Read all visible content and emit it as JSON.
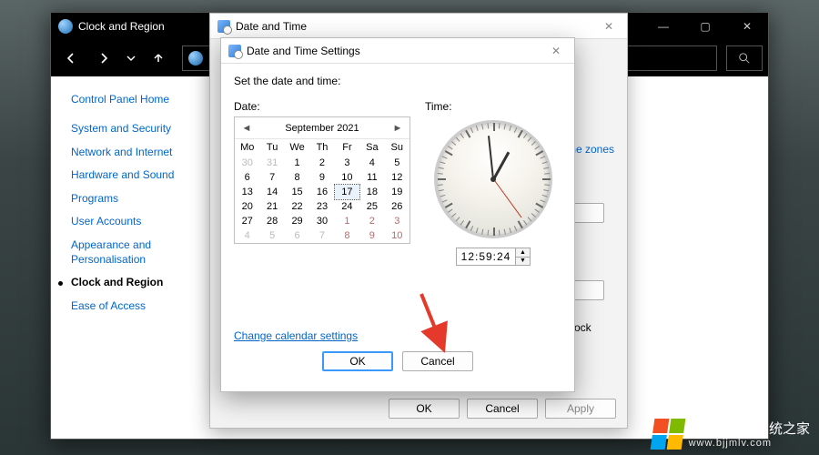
{
  "outer_window": {
    "title": "Clock and Region"
  },
  "sidebar": {
    "home": "Control Panel Home",
    "items": [
      {
        "label": "System and Security"
      },
      {
        "label": "Network and Internet"
      },
      {
        "label": "Hardware and Sound"
      },
      {
        "label": "Programs"
      },
      {
        "label": "User Accounts"
      },
      {
        "label": "Appearance and Personalisation"
      },
      {
        "label": "Clock and Region",
        "active": true
      },
      {
        "label": "Ease of Access"
      }
    ]
  },
  "dlg1": {
    "title": "Date and Time",
    "link_fragment": "fferent time zones",
    "ock_fragment": "ock",
    "buttons": {
      "ok": "OK",
      "cancel": "Cancel",
      "apply": "Apply"
    }
  },
  "dlg2": {
    "title": "Date and Time Settings",
    "instruction": "Set the date and time:",
    "date_label": "Date:",
    "time_label": "Time:",
    "month": "September 2021",
    "dow": [
      "Mo",
      "Tu",
      "We",
      "Th",
      "Fr",
      "Sa",
      "Su"
    ],
    "weeks": [
      [
        {
          "d": "30",
          "o": true
        },
        {
          "d": "31",
          "o": true
        },
        {
          "d": "1"
        },
        {
          "d": "2"
        },
        {
          "d": "3"
        },
        {
          "d": "4"
        },
        {
          "d": "5"
        }
      ],
      [
        {
          "d": "6"
        },
        {
          "d": "7"
        },
        {
          "d": "8"
        },
        {
          "d": "9"
        },
        {
          "d": "10"
        },
        {
          "d": "11"
        },
        {
          "d": "12"
        }
      ],
      [
        {
          "d": "13"
        },
        {
          "d": "14"
        },
        {
          "d": "15"
        },
        {
          "d": "16"
        },
        {
          "d": "17",
          "sel": true
        },
        {
          "d": "18"
        },
        {
          "d": "19"
        }
      ],
      [
        {
          "d": "20"
        },
        {
          "d": "21"
        },
        {
          "d": "22"
        },
        {
          "d": "23"
        },
        {
          "d": "24"
        },
        {
          "d": "25"
        },
        {
          "d": "26"
        }
      ],
      [
        {
          "d": "27"
        },
        {
          "d": "28"
        },
        {
          "d": "29"
        },
        {
          "d": "30"
        },
        {
          "d": "1",
          "o": true,
          "wk": true
        },
        {
          "d": "2",
          "o": true,
          "wk": true
        },
        {
          "d": "3",
          "o": true,
          "wk": true
        }
      ],
      [
        {
          "d": "4",
          "o": true
        },
        {
          "d": "5",
          "o": true
        },
        {
          "d": "6",
          "o": true
        },
        {
          "d": "7",
          "o": true
        },
        {
          "d": "8",
          "o": true,
          "wk": true
        },
        {
          "d": "9",
          "o": true,
          "wk": true
        },
        {
          "d": "10",
          "o": true,
          "wk": true
        }
      ]
    ],
    "time_value": "12:59:24",
    "clock": {
      "hour_angle": 29,
      "min_angle": 354,
      "sec_angle": 144
    },
    "link": "Change calendar settings",
    "buttons": {
      "ok": "OK",
      "cancel": "Cancel"
    }
  },
  "watermark": {
    "brand": "Windows",
    "zh": "系统之家",
    "url": "www.bjjmlv.com"
  }
}
